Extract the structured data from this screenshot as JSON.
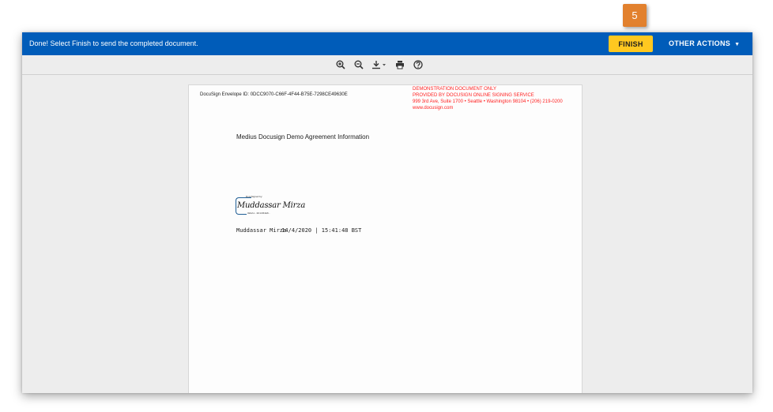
{
  "step_badge": "5",
  "topbar": {
    "message": "Done! Select Finish to send the completed document.",
    "finish_label": "FINISH",
    "other_actions_label": "OTHER ACTIONS",
    "bg_color": "#005cb9",
    "finish_color": "#ffc820"
  },
  "toolbar": {
    "tools": [
      {
        "name": "zoom-in-icon"
      },
      {
        "name": "zoom-out-icon"
      },
      {
        "name": "download-icon"
      },
      {
        "name": "print-icon"
      },
      {
        "name": "help-icon"
      }
    ]
  },
  "document": {
    "envelope_id": "DocuSign Envelope ID: 0DCC9070-C66F-4F44-B75E-7298CE49630E",
    "demo_notice": [
      "DEMONSTRATION DOCUMENT ONLY",
      "PROVIDED BY DOCUSIGN ONLINE SIGNING SERVICE",
      "999 3rd Ave, Suite 1700  • Seattle • Washington 98104 • (206) 219-0200",
      "www.docusign.com"
    ],
    "title": "Medius Docusign Demo Agreement Information",
    "signature": {
      "label": "DocuSigned by:",
      "name": "Muddassar Mirza",
      "code": "0E9A1...3D1CB4E8..."
    },
    "signer_name": "Muddassar Mirza",
    "signed_date": "14/4/2020 | 15:41:48 BST"
  }
}
